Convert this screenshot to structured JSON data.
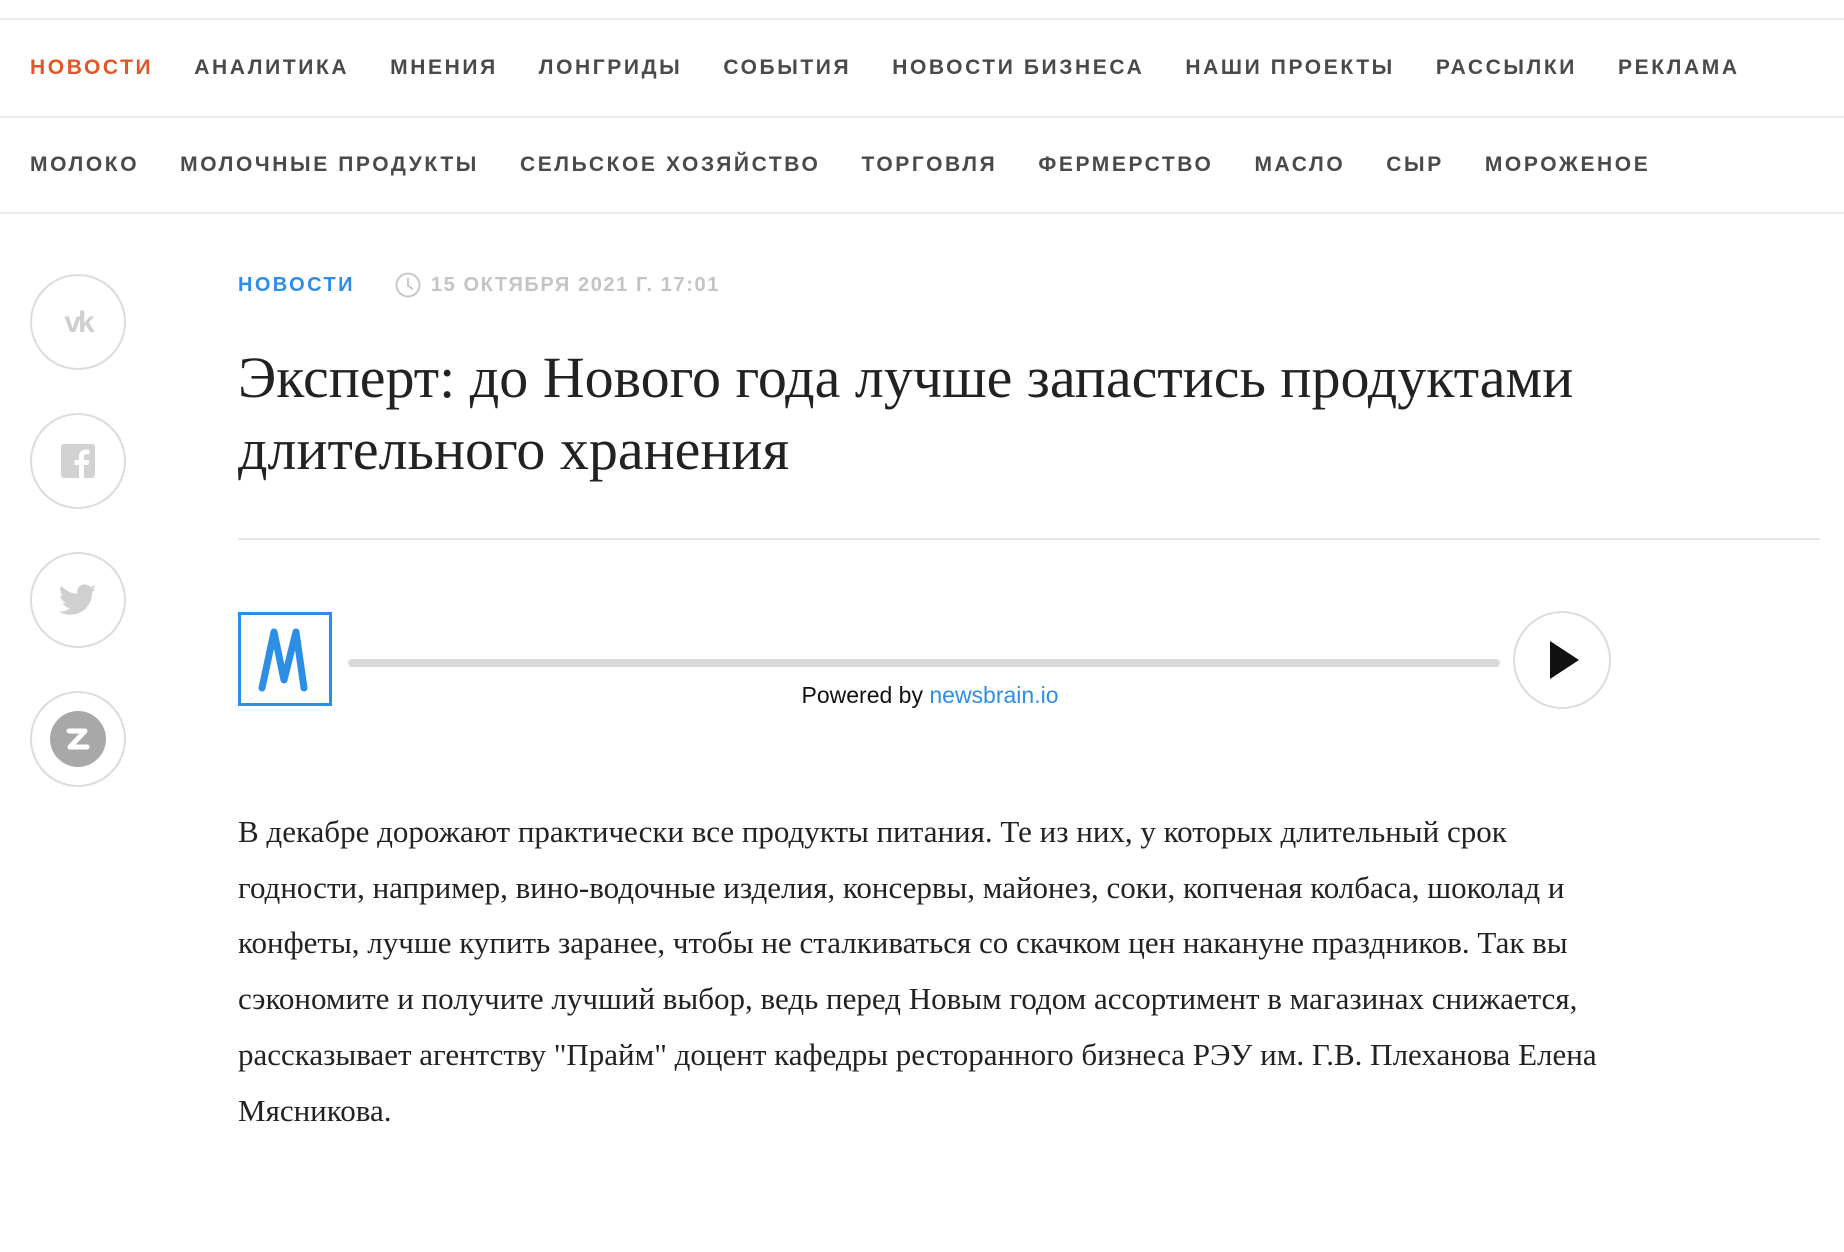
{
  "nav_primary": [
    {
      "label": "НОВОСТИ",
      "active": true
    },
    {
      "label": "АНАЛИТИКА"
    },
    {
      "label": "МНЕНИЯ"
    },
    {
      "label": "ЛОНГРИДЫ"
    },
    {
      "label": "СОБЫТИЯ"
    },
    {
      "label": "НОВОСТИ БИЗНЕСА"
    },
    {
      "label": "НАШИ ПРОЕКТЫ"
    },
    {
      "label": "РАССЫЛКИ"
    },
    {
      "label": "РЕКЛАМА"
    }
  ],
  "nav_tags": [
    {
      "label": "МОЛОКО"
    },
    {
      "label": "МОЛОЧНЫЕ ПРОДУКТЫ"
    },
    {
      "label": "СЕЛЬСКОЕ ХОЗЯЙСТВО"
    },
    {
      "label": "ТОРГОВЛЯ"
    },
    {
      "label": "ФЕРМЕРСТВО"
    },
    {
      "label": "МАСЛО"
    },
    {
      "label": "СЫР"
    },
    {
      "label": "МОРОЖЕНОЕ"
    }
  ],
  "share": [
    {
      "icon": "vk-icon"
    },
    {
      "icon": "facebook-icon"
    },
    {
      "icon": "twitter-icon"
    },
    {
      "icon": "zen-icon"
    }
  ],
  "article": {
    "category": "НОВОСТИ",
    "date": "15 ОКТЯБРЯ 2021 Г. 17:01",
    "title": "Эксперт: до Нового года лучше запастись продуктами длительного хранения",
    "body": " В декабре дорожают практически все продукты питания. Те из них, у которых длительный срок годности, например, вино-водочные изделия, консервы, майонез, соки, копченая колбаса, шоколад и конфеты, лучше купить заранее, чтобы не сталкиваться со скачком цен накануне праздников. Так вы сэкономите и получите лучший выбор, ведь перед Новым годом ассортимент в магазинах снижается, рассказывает агентству \"Прайм\" доцент кафедры ресторанного бизнеса РЭУ им. Г.В. Плеханова Елена Мясникова."
  },
  "player": {
    "logo_icon": "newsbrain-m-logo",
    "credit_prefix": "Powered by ",
    "credit_link": "newsbrain.io",
    "play_icon": "play-icon",
    "progress": 0
  },
  "colors": {
    "accent": "#e0582a",
    "link": "#2d8ee6",
    "nav_text": "#4a4a4a",
    "muted": "#c4c4c4"
  }
}
